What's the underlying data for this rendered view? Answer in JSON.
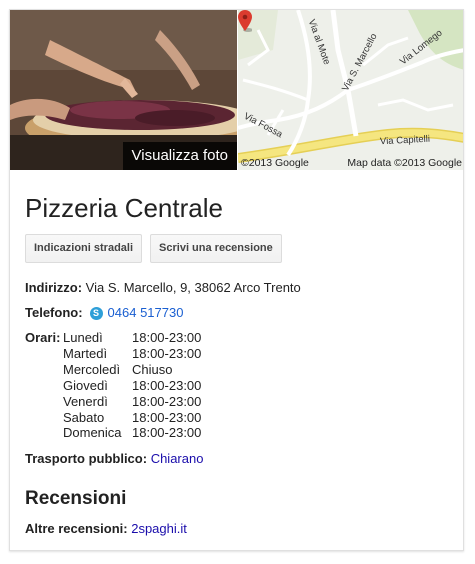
{
  "photo": {
    "caption": "Visualizza foto"
  },
  "map": {
    "streets": [
      "Via al Mote",
      "Via Lomego",
      "Via S. Marcello",
      "Via Fossa",
      "Via Capitelli"
    ],
    "copyright_left": "©2013 Google",
    "copyright_right": "Map data ©2013 Google",
    "colors": {
      "road_major": "#f5e680",
      "road_minor": "#ffffff",
      "green": "#d5e5c2",
      "pin": "#db3b2e"
    }
  },
  "place": {
    "name": "Pizzeria Centrale",
    "buttons": {
      "directions": "Indicazioni stradali",
      "review": "Scrivi una recensione"
    },
    "address_label": "Indirizzo:",
    "address": "Via S. Marcello, 9, 38062 Arco Trento",
    "phone_label": "Telefono:",
    "phone": "0464 517730",
    "hours_label": "Orari:",
    "hours": [
      {
        "day": "Lunedì",
        "time": "18:00-23:00"
      },
      {
        "day": "Martedì",
        "time": "18:00-23:00"
      },
      {
        "day": "Mercoledì",
        "time": "Chiuso"
      },
      {
        "day": "Giovedì",
        "time": "18:00-23:00"
      },
      {
        "day": "Venerdì",
        "time": "18:00-23:00"
      },
      {
        "day": "Sabato",
        "time": "18:00-23:00"
      },
      {
        "day": "Domenica",
        "time": "18:00-23:00"
      }
    ],
    "transport_label": "Trasporto pubblico:",
    "transport": "Chiarano",
    "reviews_title": "Recensioni",
    "more_reviews_label": "Altre recensioni:",
    "more_reviews_link": "2spaghi.it"
  }
}
